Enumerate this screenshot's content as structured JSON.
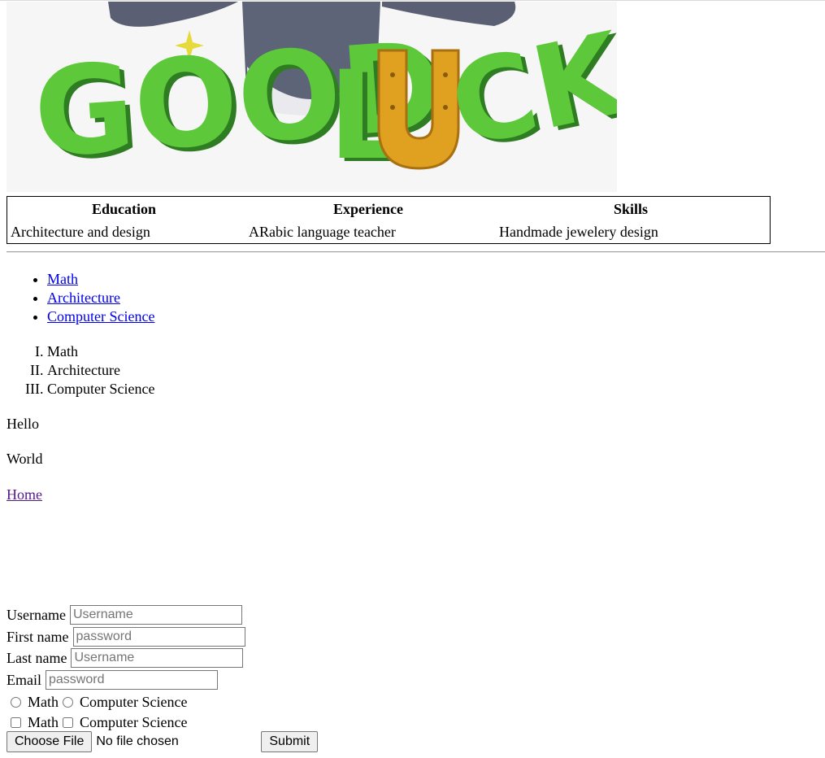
{
  "banner": {
    "text": "GOOD LUCK",
    "colors": {
      "letters": "#5cc83a",
      "letter_shadow": "#2f7d22",
      "horseshoe": "#e0a020",
      "background": "#f6f6f6"
    }
  },
  "table": {
    "headers": [
      "Education",
      "Experience",
      "Skills"
    ],
    "row": [
      "Architecture and design",
      "ARabic language teacher",
      "Handmade jewelery design"
    ]
  },
  "links_list": [
    "Math",
    "Architecture",
    "Computer Science"
  ],
  "ordered_list": [
    "Math",
    "Architecture",
    "Computer Science"
  ],
  "paragraphs": [
    "Hello",
    "World"
  ],
  "home_link": "Home",
  "form": {
    "username": {
      "label": "Username",
      "placeholder": "Username"
    },
    "first_name": {
      "label": "First name",
      "placeholder": "password"
    },
    "last_name": {
      "label": "Last name",
      "placeholder": "Username"
    },
    "email": {
      "label": "Email",
      "placeholder": "password"
    },
    "radios": [
      "Math",
      "Computer Science"
    ],
    "checkboxes": [
      "Math",
      "Computer Science"
    ],
    "file_button": "Choose File",
    "file_status": "No file chosen",
    "submit": "Submit"
  }
}
